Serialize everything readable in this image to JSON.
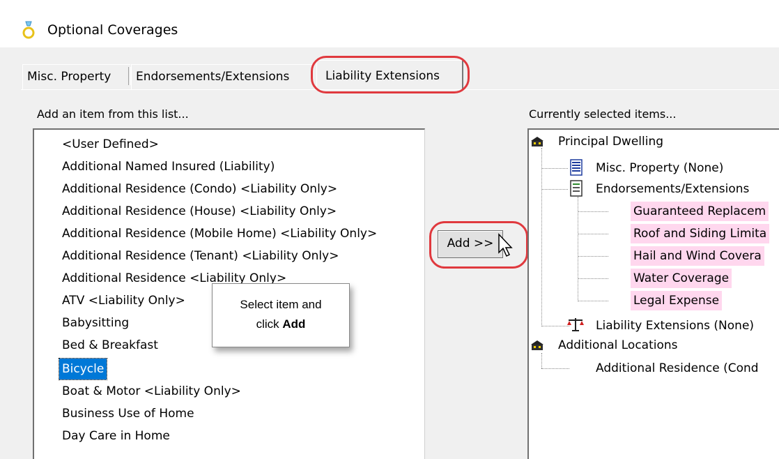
{
  "window": {
    "title": "Optional Coverages"
  },
  "tabs": [
    {
      "label": "Misc. Property",
      "active": false
    },
    {
      "label": "Endorsements/Extensions",
      "active": false
    },
    {
      "label": "Liability Extensions",
      "active": true
    }
  ],
  "left": {
    "heading": "Add an item from this list...",
    "items": [
      {
        "label": "<User Defined>"
      },
      {
        "label": "Additional Named Insured (Liability)"
      },
      {
        "label": "Additional Residence (Condo) <Liability Only>"
      },
      {
        "label": "Additional Residence (House) <Liability Only>"
      },
      {
        "label": "Additional Residence (Mobile Home) <Liability Only>"
      },
      {
        "label": "Additional Residence (Tenant) <Liability Only>"
      },
      {
        "label": "Additional Residence <Liability Only>"
      },
      {
        "label": "ATV <Liability Only>"
      },
      {
        "label": "Babysitting"
      },
      {
        "label": "Bed & Breakfast"
      },
      {
        "label": "Bicycle",
        "selected": true
      },
      {
        "label": "Boat & Motor <Liability Only>"
      },
      {
        "label": "Business Use of Home"
      },
      {
        "label": "Day Care in Home"
      }
    ]
  },
  "tooltip": {
    "line1": "Select item and",
    "line2_prefix": "click ",
    "line2_bold": "Add"
  },
  "add_button": {
    "label": "Add >>"
  },
  "right": {
    "heading": "Currently selected items...",
    "tree": {
      "principal": "Principal Dwelling",
      "misc": "Misc. Property (None)",
      "endorse": "Endorsements/Extensions",
      "endorse_children": [
        "Guaranteed Replacem",
        "Roof and Siding Limita",
        "Hail and Wind Covera",
        "Water Coverage",
        "Legal Expense"
      ],
      "liability": "Liability Extensions (None)",
      "additional": "Additional Locations",
      "additional_child": "Additional Residence (Cond"
    }
  },
  "colors": {
    "highlight_ring": "#e0393e",
    "selection": "#0078d7",
    "pink_highlight": "#ffd7ee"
  }
}
